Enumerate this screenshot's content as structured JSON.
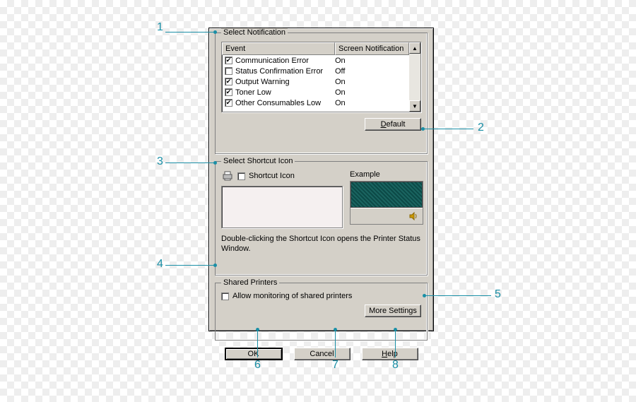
{
  "groups": {
    "notification": "Select Notification",
    "shortcut": "Select Shortcut Icon",
    "shared": "Shared Printers"
  },
  "table": {
    "headers": {
      "event": "Event",
      "screen": "Screen Notification"
    },
    "rows": [
      {
        "checked": true,
        "label": "Communication Error",
        "value": "On"
      },
      {
        "checked": false,
        "label": "Status Confirmation Error",
        "value": "Off"
      },
      {
        "checked": true,
        "label": "Output Warning",
        "value": "On"
      },
      {
        "checked": true,
        "label": "Toner Low",
        "value": "On"
      },
      {
        "checked": true,
        "label": "Other Consumables Low",
        "value": "On"
      }
    ]
  },
  "buttons": {
    "default": "Default",
    "moresettings": "More Settings",
    "ok": "OK",
    "cancel": "Cancel",
    "help": "Help"
  },
  "shortcut": {
    "checkbox": "Shortcut Icon",
    "example": "Example",
    "hint": "Double-clicking the Shortcut Icon opens the Printer Status Window."
  },
  "shared": {
    "checkbox": "Allow monitoring of shared printers"
  },
  "callouts": {
    "c1": "1",
    "c2": "2",
    "c3": "3",
    "c4": "4",
    "c5": "5",
    "c6": "6",
    "c7": "7",
    "c8": "8"
  }
}
